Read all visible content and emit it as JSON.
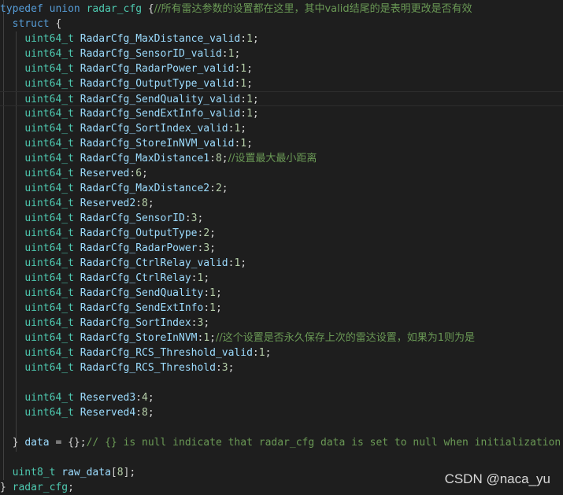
{
  "watermark": "CSDN @naca_yu",
  "code_lines": [
    [
      [
        "kw",
        "typedef "
      ],
      [
        "kw",
        "union "
      ],
      [
        "ty",
        "radar_cfg "
      ],
      [
        "pn",
        "{"
      ],
      [
        "cm",
        "//所有雷达参数的设置都在这里，其中valid结尾的是表明更改是否有效"
      ]
    ],
    [
      [
        "pn",
        "  "
      ],
      [
        "kw",
        "struct "
      ],
      [
        "pn",
        "{"
      ]
    ],
    [
      [
        "pn",
        "    "
      ],
      [
        "ty",
        "uint64_t "
      ],
      [
        "id",
        "RadarCfg_MaxDistance_valid"
      ],
      [
        "pn",
        ":"
      ],
      [
        "nm",
        "1"
      ],
      [
        "pn",
        ";"
      ]
    ],
    [
      [
        "pn",
        "    "
      ],
      [
        "ty",
        "uint64_t "
      ],
      [
        "id",
        "RadarCfg_SensorID_valid"
      ],
      [
        "pn",
        ":"
      ],
      [
        "nm",
        "1"
      ],
      [
        "pn",
        ";"
      ]
    ],
    [
      [
        "pn",
        "    "
      ],
      [
        "ty",
        "uint64_t "
      ],
      [
        "id",
        "RadarCfg_RadarPower_valid"
      ],
      [
        "pn",
        ":"
      ],
      [
        "nm",
        "1"
      ],
      [
        "pn",
        ";"
      ]
    ],
    [
      [
        "pn",
        "    "
      ],
      [
        "ty",
        "uint64_t "
      ],
      [
        "id",
        "RadarCfg_OutputType_valid"
      ],
      [
        "pn",
        ":"
      ],
      [
        "nm",
        "1"
      ],
      [
        "pn",
        ";"
      ]
    ],
    [
      [
        "pn",
        "    "
      ],
      [
        "ty",
        "uint64_t "
      ],
      [
        "id",
        "RadarCfg_SendQuality_valid"
      ],
      [
        "pn",
        ":"
      ],
      [
        "nm",
        "1"
      ],
      [
        "pn",
        ";"
      ]
    ],
    [
      [
        "pn",
        "    "
      ],
      [
        "ty",
        "uint64_t "
      ],
      [
        "id",
        "RadarCfg_SendExtInfo_valid"
      ],
      [
        "pn",
        ":"
      ],
      [
        "nm",
        "1"
      ],
      [
        "pn",
        ";"
      ]
    ],
    [
      [
        "pn",
        "    "
      ],
      [
        "ty",
        "uint64_t "
      ],
      [
        "id",
        "RadarCfg_SortIndex_valid"
      ],
      [
        "pn",
        ":"
      ],
      [
        "nm",
        "1"
      ],
      [
        "pn",
        ";"
      ]
    ],
    [
      [
        "pn",
        "    "
      ],
      [
        "ty",
        "uint64_t "
      ],
      [
        "id",
        "RadarCfg_StoreInNVM_valid"
      ],
      [
        "pn",
        ":"
      ],
      [
        "nm",
        "1"
      ],
      [
        "pn",
        ";"
      ]
    ],
    [
      [
        "pn",
        "    "
      ],
      [
        "ty",
        "uint64_t "
      ],
      [
        "id",
        "RadarCfg_MaxDistance1"
      ],
      [
        "pn",
        ":"
      ],
      [
        "nm",
        "8"
      ],
      [
        "pn",
        ";"
      ],
      [
        "cm",
        "//设置最大最小距离"
      ]
    ],
    [
      [
        "pn",
        "    "
      ],
      [
        "ty",
        "uint64_t "
      ],
      [
        "id",
        "Reserved"
      ],
      [
        "pn",
        ":"
      ],
      [
        "nm",
        "6"
      ],
      [
        "pn",
        ";"
      ]
    ],
    [
      [
        "pn",
        "    "
      ],
      [
        "ty",
        "uint64_t "
      ],
      [
        "id",
        "RadarCfg_MaxDistance2"
      ],
      [
        "pn",
        ":"
      ],
      [
        "nm",
        "2"
      ],
      [
        "pn",
        ";"
      ]
    ],
    [
      [
        "pn",
        "    "
      ],
      [
        "ty",
        "uint64_t "
      ],
      [
        "id",
        "Reserved2"
      ],
      [
        "pn",
        ":"
      ],
      [
        "nm",
        "8"
      ],
      [
        "pn",
        ";"
      ]
    ],
    [
      [
        "pn",
        "    "
      ],
      [
        "ty",
        "uint64_t "
      ],
      [
        "id",
        "RadarCfg_SensorID"
      ],
      [
        "pn",
        ":"
      ],
      [
        "nm",
        "3"
      ],
      [
        "pn",
        ";"
      ]
    ],
    [
      [
        "pn",
        "    "
      ],
      [
        "ty",
        "uint64_t "
      ],
      [
        "id",
        "RadarCfg_OutputType"
      ],
      [
        "pn",
        ":"
      ],
      [
        "nm",
        "2"
      ],
      [
        "pn",
        ";"
      ]
    ],
    [
      [
        "pn",
        "    "
      ],
      [
        "ty",
        "uint64_t "
      ],
      [
        "id",
        "RadarCfg_RadarPower"
      ],
      [
        "pn",
        ":"
      ],
      [
        "nm",
        "3"
      ],
      [
        "pn",
        ";"
      ]
    ],
    [
      [
        "pn",
        "    "
      ],
      [
        "ty",
        "uint64_t "
      ],
      [
        "id",
        "RadarCfg_CtrlRelay_valid"
      ],
      [
        "pn",
        ":"
      ],
      [
        "nm",
        "1"
      ],
      [
        "pn",
        ";"
      ]
    ],
    [
      [
        "pn",
        "    "
      ],
      [
        "ty",
        "uint64_t "
      ],
      [
        "id",
        "RadarCfg_CtrlRelay"
      ],
      [
        "pn",
        ":"
      ],
      [
        "nm",
        "1"
      ],
      [
        "pn",
        ";"
      ]
    ],
    [
      [
        "pn",
        "    "
      ],
      [
        "ty",
        "uint64_t "
      ],
      [
        "id",
        "RadarCfg_SendQuality"
      ],
      [
        "pn",
        ":"
      ],
      [
        "nm",
        "1"
      ],
      [
        "pn",
        ";"
      ]
    ],
    [
      [
        "pn",
        "    "
      ],
      [
        "ty",
        "uint64_t "
      ],
      [
        "id",
        "RadarCfg_SendExtInfo"
      ],
      [
        "pn",
        ":"
      ],
      [
        "nm",
        "1"
      ],
      [
        "pn",
        ";"
      ]
    ],
    [
      [
        "pn",
        "    "
      ],
      [
        "ty",
        "uint64_t "
      ],
      [
        "id",
        "RadarCfg_SortIndex"
      ],
      [
        "pn",
        ":"
      ],
      [
        "nm",
        "3"
      ],
      [
        "pn",
        ";"
      ]
    ],
    [
      [
        "pn",
        "    "
      ],
      [
        "ty",
        "uint64_t "
      ],
      [
        "id",
        "RadarCfg_StoreInNVM"
      ],
      [
        "pn",
        ":"
      ],
      [
        "nm",
        "1"
      ],
      [
        "pn",
        ";"
      ],
      [
        "cm",
        "//这个设置是否永久保存上次的雷达设置，如果为1则为是"
      ]
    ],
    [
      [
        "pn",
        "    "
      ],
      [
        "ty",
        "uint64_t "
      ],
      [
        "id",
        "RadarCfg_RCS_Threshold_valid"
      ],
      [
        "pn",
        ":"
      ],
      [
        "nm",
        "1"
      ],
      [
        "pn",
        ";"
      ]
    ],
    [
      [
        "pn",
        "    "
      ],
      [
        "ty",
        "uint64_t "
      ],
      [
        "id",
        "RadarCfg_RCS_Threshold"
      ],
      [
        "pn",
        ":"
      ],
      [
        "nm",
        "3"
      ],
      [
        "pn",
        ";"
      ]
    ],
    [],
    [
      [
        "pn",
        "    "
      ],
      [
        "ty",
        "uint64_t "
      ],
      [
        "id",
        "Reserved3"
      ],
      [
        "pn",
        ":"
      ],
      [
        "nm",
        "4"
      ],
      [
        "pn",
        ";"
      ]
    ],
    [
      [
        "pn",
        "    "
      ],
      [
        "ty",
        "uint64_t "
      ],
      [
        "id",
        "Reserved4"
      ],
      [
        "pn",
        ":"
      ],
      [
        "nm",
        "8"
      ],
      [
        "pn",
        ";"
      ]
    ],
    [],
    [
      [
        "pn",
        "  } "
      ],
      [
        "id",
        "data"
      ],
      [
        "pn",
        " = {};"
      ],
      [
        "cm",
        "// {} is null indicate that radar_cfg data is set to null when initialization"
      ]
    ],
    [],
    [
      [
        "pn",
        "  "
      ],
      [
        "ty",
        "uint8_t "
      ],
      [
        "id",
        "raw_data"
      ],
      [
        "pn",
        "["
      ],
      [
        "nm",
        "8"
      ],
      [
        "pn",
        "];"
      ]
    ],
    [
      [
        "pn",
        "} "
      ],
      [
        "ty",
        "radar_cfg"
      ],
      [
        "pn",
        ";"
      ]
    ]
  ],
  "highlighted_line": 6
}
